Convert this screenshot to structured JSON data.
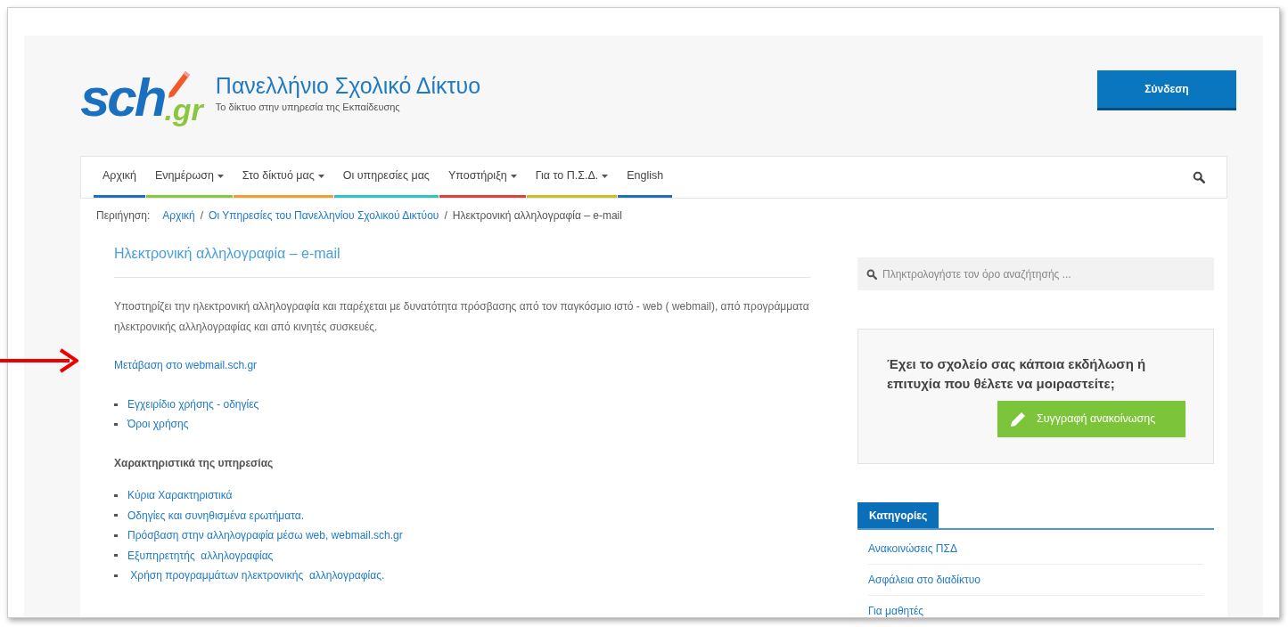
{
  "header": {
    "logo_main": "sch",
    "logo_suffix": ".gr",
    "site_title": "Πανελλήνιο Σχολικό Δίκτυο",
    "tagline": "Το δίκτυο στην υπηρεσία της Εκπαίδευσης",
    "login_button": "Σύνδεση"
  },
  "nav": [
    {
      "label": "Αρχική",
      "has_dropdown": false,
      "color": "#1f6fbf"
    },
    {
      "label": "Ενημέρωση",
      "has_dropdown": true,
      "color": "#8cc63f"
    },
    {
      "label": "Στο δίκτυό μας",
      "has_dropdown": true,
      "color": "#f0a030"
    },
    {
      "label": "Οι υπηρεσίες μας",
      "has_dropdown": false,
      "color": "#2ec4c4"
    },
    {
      "label": "Υποστήριξη",
      "has_dropdown": true,
      "color": "#e04040"
    },
    {
      "label": "Για το Π.Σ.Δ.",
      "has_dropdown": true,
      "color": "#c8c020"
    },
    {
      "label": "English",
      "has_dropdown": false,
      "color": "#1f6fbf"
    }
  ],
  "breadcrumb": {
    "label": "Περιήγηση:",
    "separator": "/",
    "items": [
      "Αρχική",
      "Οι Υπηρεσίες του Πανελληνίου Σχολικού Δικτύου",
      "Ηλεκτρονική αλληλογραφία – e-mail"
    ]
  },
  "article": {
    "title": "Ηλεκτρονική αλληλογραφία – e-mail",
    "intro": "Υποστηρίζει την ηλεκτρονική αλληλογραφία και παρέχεται με  δυνατότητα πρόσβασης από τον παγκόσμιο ιστό - web  ( webmail), από προγράμματα ηλεκτρονικής αλληλογραφίας και από κινητές συσκευές.",
    "webmail_link": "Μετάβαση στο webmail.sch.gr",
    "doc_links": [
      "Εγχειρίδιο χρήσης - οδηγίες",
      "Όροι χρήσης"
    ],
    "features_heading": "Χαρακτηριστικά της υπηρεσίας",
    "feature_links": [
      "Κύρια Χαρακτηριστικά",
      "Οδηγίες και συνηθισμένα ερωτήματα.",
      "Πρόσβαση στην αλληλογραφία μέσω web, webmail.sch.gr",
      "Εξυπηρετητής  αλληλογραφίας",
      " Χρήση προγραμμάτων ηλεκτρονικής  αλληλογραφίας."
    ]
  },
  "sidebar": {
    "search": {
      "placeholder": "Πληκτρολογήστε τον όρο αναζήτησής ..."
    },
    "promo": {
      "text": "Έχει το σχολείο σας κάποια εκδήλωση ή επιτυχία που θέλετε να μοιραστείτε;",
      "button": "Συγγραφή ανακοίνωσης"
    },
    "categories": {
      "tab": "Κατηγορίες",
      "items": [
        "Ανακοινώσεις ΠΣΔ",
        "Ασφάλεια στο διαδίκτυο",
        "Για μαθητές"
      ]
    }
  }
}
